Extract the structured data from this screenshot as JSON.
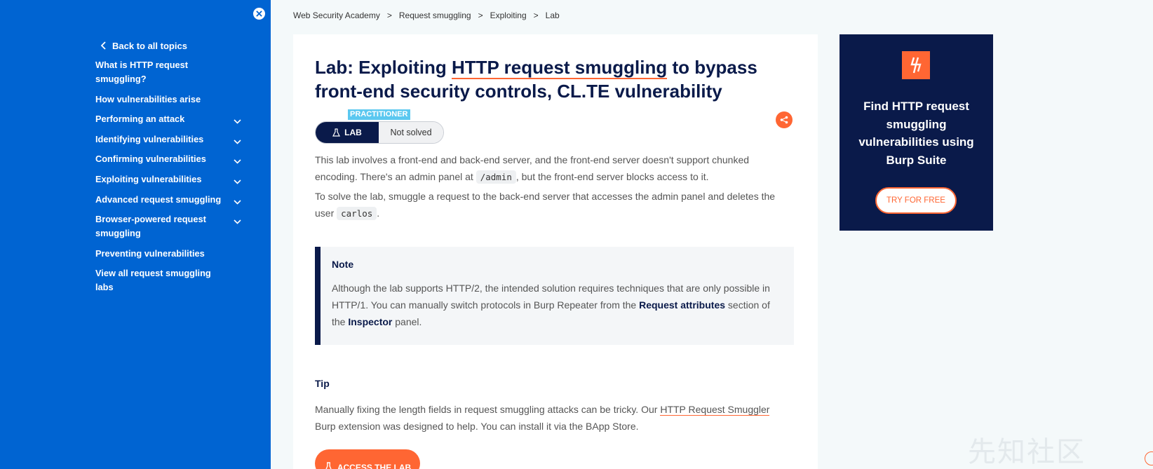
{
  "sidebar": {
    "back_label": "Back to all topics",
    "items": [
      {
        "label": "What is HTTP request smuggling?",
        "expandable": false
      },
      {
        "label": "How vulnerabilities arise",
        "expandable": false
      },
      {
        "label": "Performing an attack",
        "expandable": true
      },
      {
        "label": "Identifying vulnerabilities",
        "expandable": true
      },
      {
        "label": "Confirming vulnerabilities",
        "expandable": true
      },
      {
        "label": "Exploiting vulnerabilities",
        "expandable": true
      },
      {
        "label": "Advanced request smuggling",
        "expandable": true
      },
      {
        "label": "Browser-powered request smuggling",
        "expandable": true
      },
      {
        "label": "Preventing vulnerabilities",
        "expandable": false
      },
      {
        "label": "View all request smuggling labs",
        "expandable": false
      }
    ]
  },
  "breadcrumb": {
    "items": [
      "Web Security Academy",
      "Request smuggling",
      "Exploiting",
      "Lab"
    ],
    "separator": ">"
  },
  "lab": {
    "title_pre": "Lab: Exploiting ",
    "title_link": "HTTP request smuggling",
    "title_post": " to bypass front-end security controls, CL.TE vulnerability",
    "level": "PRACTITIONER",
    "type_label": "LAB",
    "status": "Not solved",
    "p1_a": "This lab involves a front-end and back-end server, and the front-end server doesn't support chunked encoding. There's an admin panel at ",
    "p1_code": "/admin",
    "p1_b": ", but the front-end server blocks access to it.",
    "p2_a": "To solve the lab, smuggle a request to the back-end server that accesses the admin panel and deletes the user ",
    "p2_code": "carlos",
    "p2_b": ".",
    "note_title": "Note",
    "note_a": "Although the lab supports HTTP/2, the intended solution requires techniques that are only possible in HTTP/1. You can manually switch protocols in Burp Repeater from the ",
    "note_b1": "Request attributes",
    "note_c": " section of the ",
    "note_b2": "Inspector",
    "note_d": " panel.",
    "tip_title": "Tip",
    "tip_a": "Manually fixing the length fields in request smuggling attacks can be tricky. Our ",
    "tip_link": "HTTP Request Smuggler",
    "tip_b": " Burp extension was designed to help. You can install it via the BApp Store.",
    "access_label": "ACCESS THE LAB"
  },
  "promo": {
    "text": "Find HTTP request smuggling vulnerabilities using Burp Suite",
    "button": "TRY FOR FREE"
  },
  "watermark": "先知社区",
  "colors": {
    "sidebar": "#0064d2",
    "navy": "#0a1a4a",
    "accent": "#ff6633",
    "practitioner": "#5bc8f0"
  }
}
